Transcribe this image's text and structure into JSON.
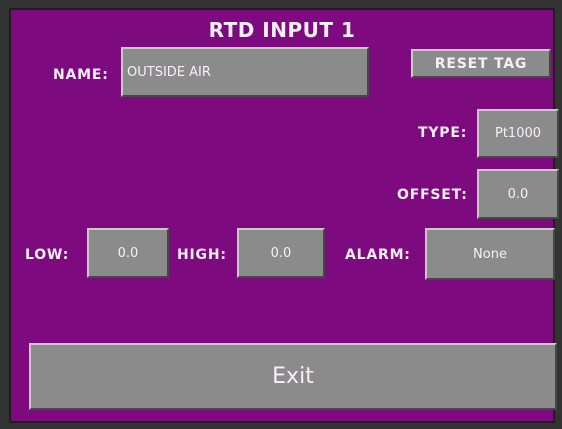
{
  "screen": {
    "title": "RTD INPUT 1"
  },
  "name_row": {
    "label": "NAME:",
    "value": "OUTSIDE AIR"
  },
  "reset_tag": {
    "label": "RESET TAG"
  },
  "type_row": {
    "label": "TYPE:",
    "value": "Pt1000"
  },
  "offset_row": {
    "label": "OFFSET:",
    "value": "0.0"
  },
  "low_row": {
    "label": "LOW:",
    "value": "0.0"
  },
  "high_row": {
    "label": "HIGH:",
    "value": "0.0"
  },
  "alarm_row": {
    "label": "ALARM:",
    "value": "None"
  },
  "exit_button": {
    "label": "Exit"
  },
  "colors": {
    "background": "#7d0b7f",
    "field": "#8b8b8b",
    "text": "#f6f0f6",
    "frame": "#333333"
  }
}
